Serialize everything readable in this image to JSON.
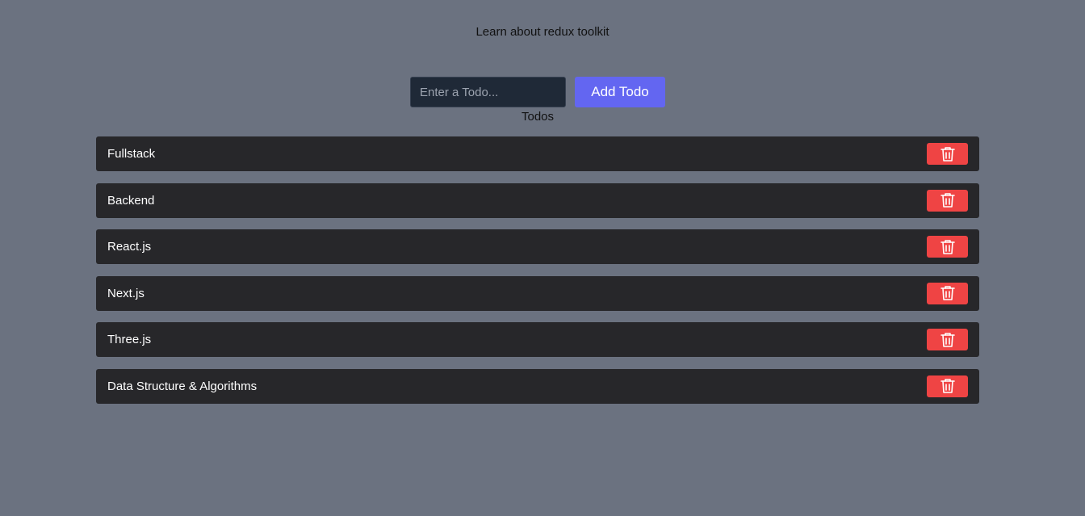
{
  "header": {
    "title": "Learn about redux toolkit"
  },
  "form": {
    "input_placeholder": "Enter a Todo...",
    "input_value": "",
    "add_button_label": "Add Todo"
  },
  "list": {
    "title": "Todos",
    "items": [
      {
        "text": "Fullstack",
        "action_icon": "trash-icon"
      },
      {
        "text": "Backend",
        "action_icon": "trash-icon"
      },
      {
        "text": "React.js",
        "action_icon": "trash-icon"
      },
      {
        "text": "Next.js",
        "action_icon": "trash-icon"
      },
      {
        "text": "Three.js",
        "action_icon": "trash-icon"
      },
      {
        "text": "Data Structure & Algorithms",
        "action_icon": "trash-icon"
      }
    ]
  },
  "colors": {
    "page_background": "#6b7280",
    "input_background": "#1f2937",
    "add_button": "#6366f1",
    "todo_item_background": "#27272a",
    "delete_button": "#ef4444"
  }
}
